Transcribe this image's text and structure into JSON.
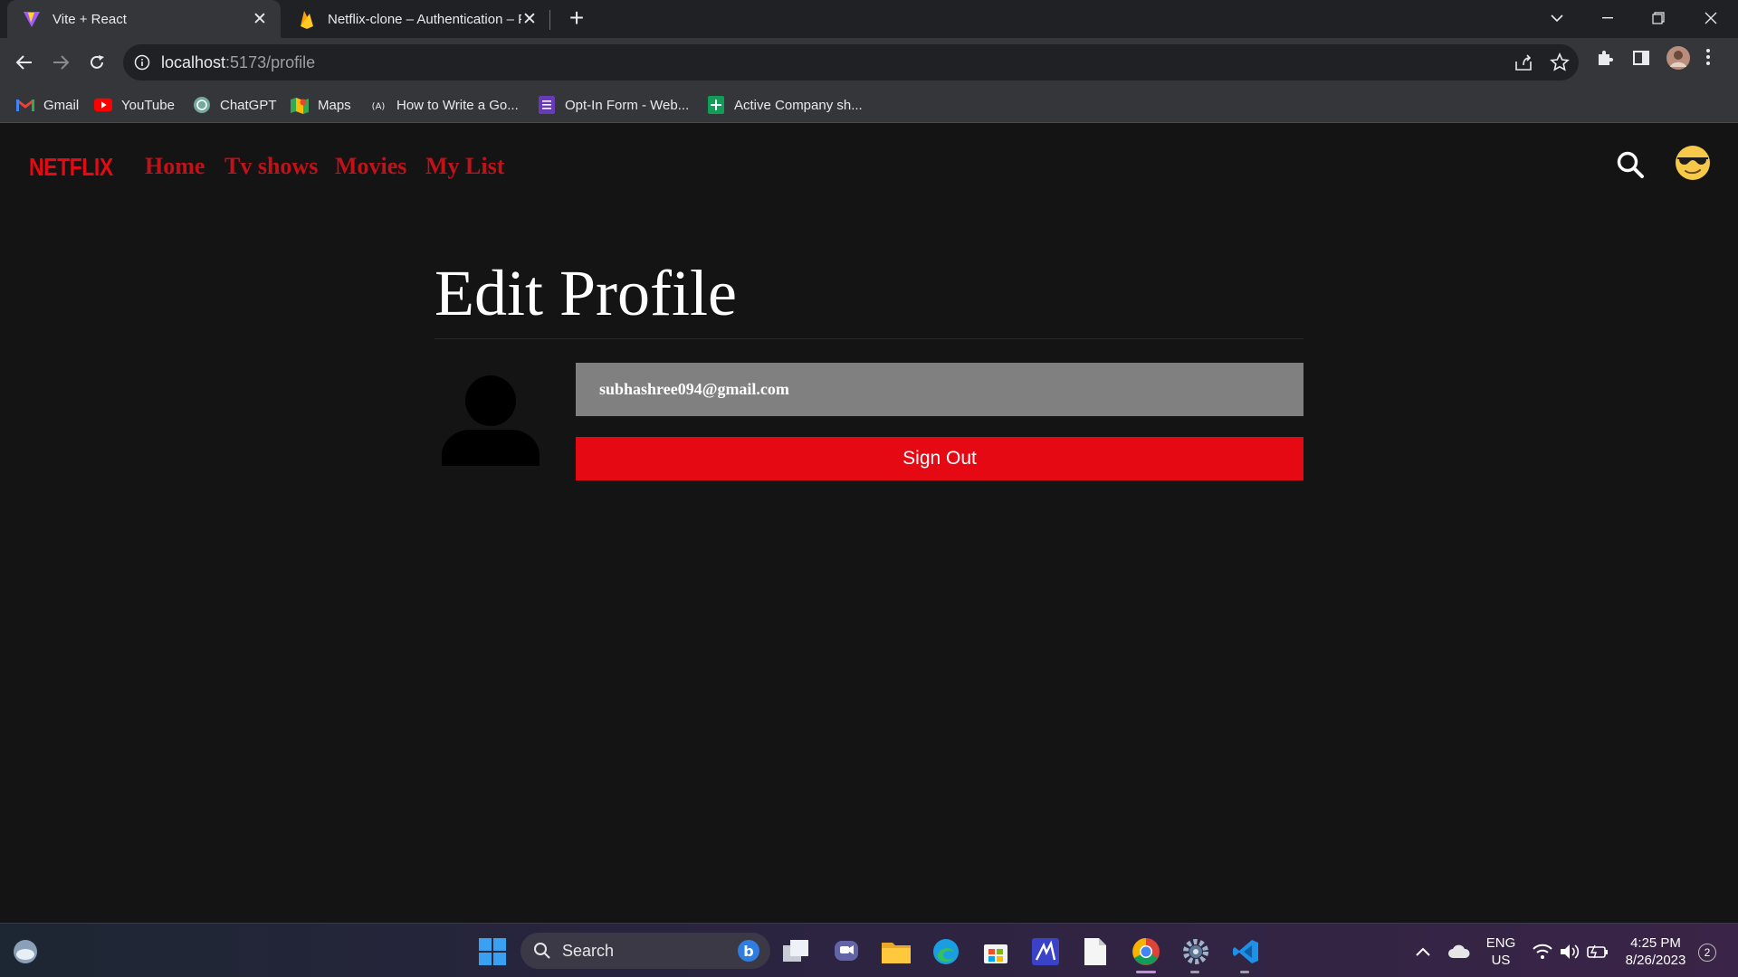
{
  "browser": {
    "tabs": [
      {
        "title": "Vite + React",
        "favicon": "vite-icon",
        "active": true
      },
      {
        "title": "Netflix-clone – Authentication – F",
        "favicon": "firebase-icon",
        "active": false
      }
    ],
    "url_host": "localhost",
    "url_path": ":5173/profile",
    "bookmarks": [
      {
        "label": "Gmail",
        "icon": "gmail-icon"
      },
      {
        "label": "YouTube",
        "icon": "youtube-icon"
      },
      {
        "label": "ChatGPT",
        "icon": "chatgpt-icon"
      },
      {
        "label": "Maps",
        "icon": "maps-icon"
      },
      {
        "label": "How to Write a Go...",
        "icon": "a-icon"
      },
      {
        "label": "Opt-In Form - Web...",
        "icon": "forms-icon"
      },
      {
        "label": "Active Company sh...",
        "icon": "sheets-icon"
      }
    ]
  },
  "app": {
    "logo": "NETFLIX",
    "nav": [
      {
        "label": "Home"
      },
      {
        "label": "Tv shows"
      },
      {
        "label": "Movies"
      },
      {
        "label": "My List"
      }
    ],
    "profile": {
      "title": "Edit Profile",
      "email": "subhashree094@gmail.com",
      "signout_label": "Sign Out"
    },
    "colors": {
      "brand": "#e50914",
      "nav_link": "#c11119",
      "background": "#141414",
      "email_box": "#808080"
    }
  },
  "taskbar": {
    "search_label": "Search",
    "lang_primary": "ENG",
    "lang_secondary": "US",
    "time": "4:25 PM",
    "date": "8/26/2023",
    "notification_count": "2"
  }
}
